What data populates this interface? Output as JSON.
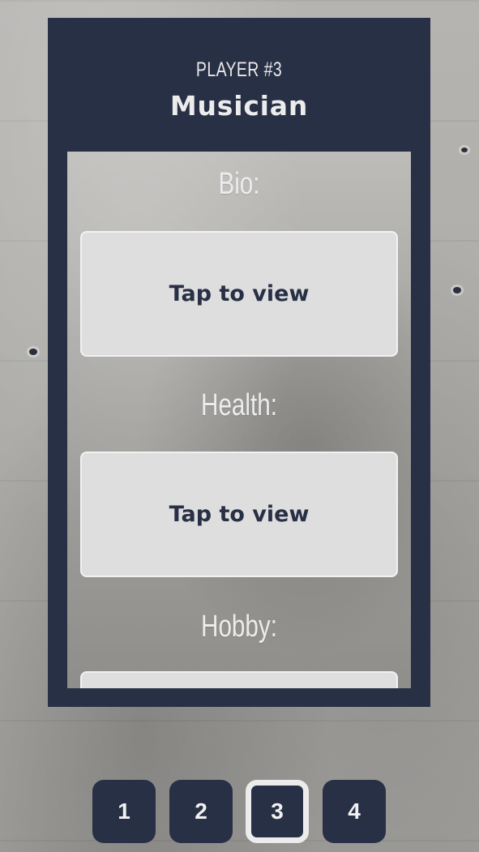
{
  "player": {
    "number_label": "PLAYER #3",
    "role": "Musician"
  },
  "sections": [
    {
      "label": "Bio:",
      "action": "Tap to view"
    },
    {
      "label": "Health:",
      "action": "Tap to view"
    },
    {
      "label": "Hobby:",
      "action": ""
    }
  ],
  "tabs": [
    {
      "label": "1",
      "active": false
    },
    {
      "label": "2",
      "active": false
    },
    {
      "label": "3",
      "active": true
    },
    {
      "label": "4",
      "active": false
    }
  ],
  "colors": {
    "card": "#283045",
    "view_box": "#dedede",
    "text_light": "#ececec"
  }
}
